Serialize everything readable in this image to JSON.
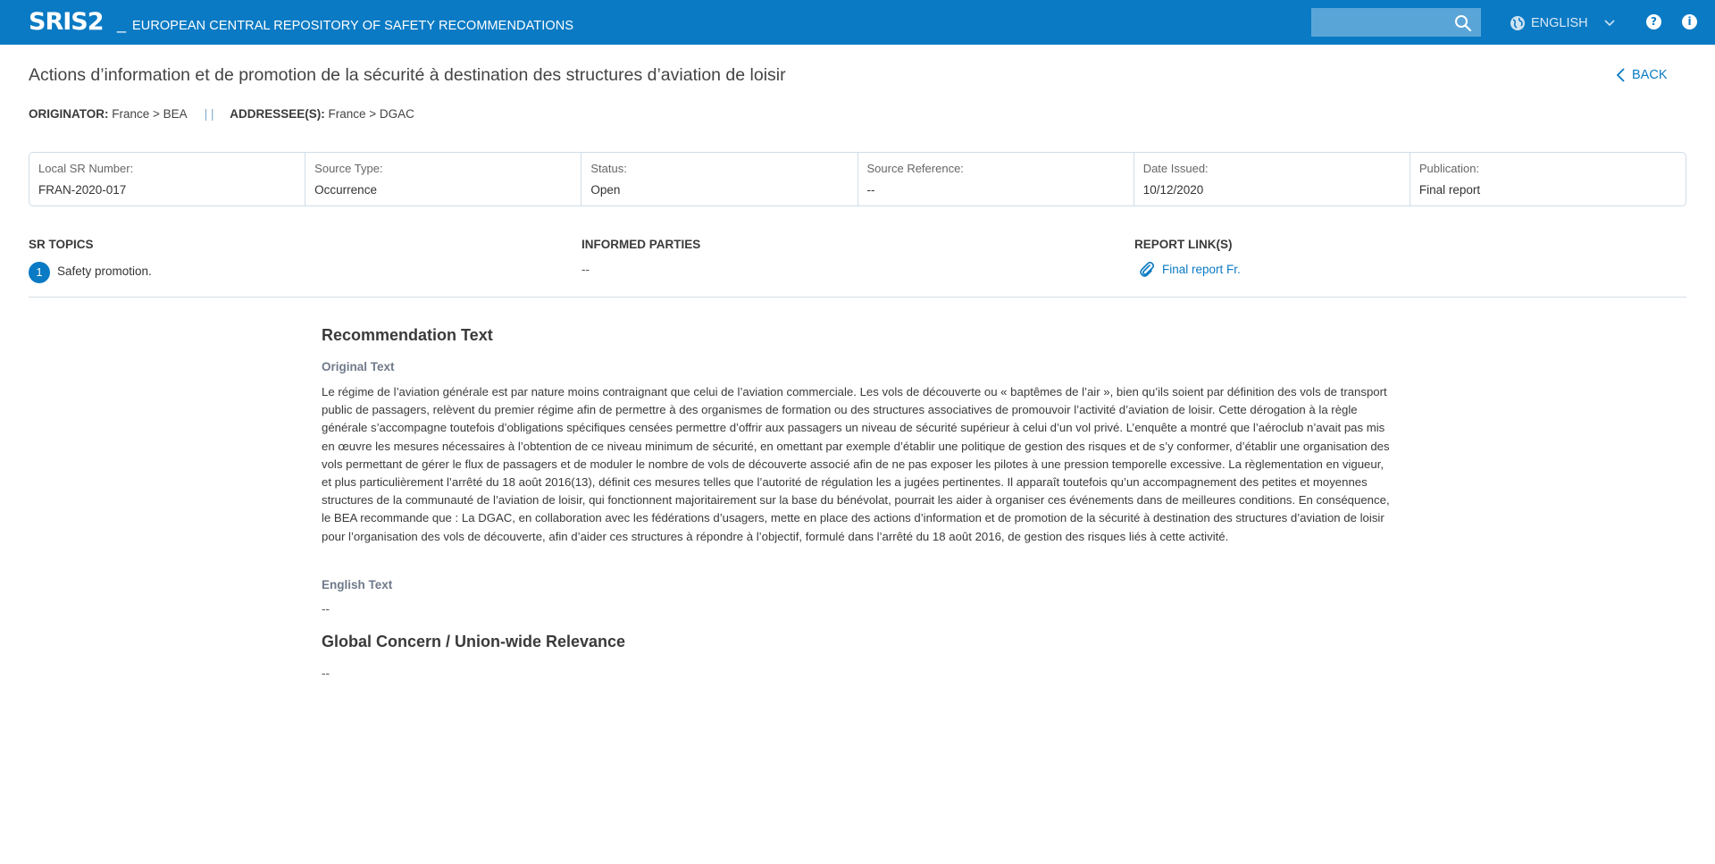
{
  "header": {
    "logo": "SRIS2",
    "dash": "_",
    "app_title": "EUROPEAN CENTRAL REPOSITORY OF SAFETY RECOMMENDATIONS",
    "search_placeholder": "",
    "language": "ENGLISH",
    "help_glyph": "?",
    "info_glyph": "i",
    "brand_color": "#0a7ac4"
  },
  "page": {
    "title": "Actions d’information et de promotion de la sécurité à destination des structures d’aviation de loisir",
    "back_label": "BACK"
  },
  "originator": {
    "originator_label": "ORIGINATOR:",
    "originator_value": "France > BEA",
    "separator": "| |",
    "addressee_label": "ADDRESSEE(S):",
    "addressee_value": "France > DGAC"
  },
  "info": [
    {
      "label": "Local SR Number:",
      "value": "FRAN-2020-017"
    },
    {
      "label": "Source Type:",
      "value": "Occurrence"
    },
    {
      "label": "Status:",
      "value": "Open"
    },
    {
      "label": "Source Reference:",
      "value": "--"
    },
    {
      "label": "Date Issued:",
      "value": "10/12/2020"
    },
    {
      "label": "Publication:",
      "value": "Final report"
    }
  ],
  "sections": {
    "sr_topics_label": "SR TOPICS",
    "topic_number": "1",
    "topic_text": "Safety promotion.",
    "informed_label": "INFORMED PARTIES",
    "informed_value": "--",
    "report_links_label": "REPORT LINK(S)",
    "report_link_text": "Final report Fr."
  },
  "recommendation": {
    "title": "Recommendation Text",
    "original_label": "Original Text",
    "original_text": "Le régime de l’aviation générale est par nature moins contraignant que celui de l’aviation commerciale. Les vols de découverte ou « baptêmes de l’air », bien qu’ils soient par définition des vols de transport public de passagers, relèvent du premier régime afin de permettre à des organismes de formation ou des structures associatives de promouvoir l’activité d’aviation de loisir. Cette dérogation à la règle générale s’accompagne toutefois d’obligations spécifiques censées permettre d’offrir aux passagers un niveau de sécurité supérieur à celui d’un vol privé. L’enquête a montré que l’aéroclub n’avait pas mis en œuvre les mesures nécessaires à l’obtention de ce niveau minimum de sécurité, en omettant par exemple d’établir une politique de gestion des risques et de s’y conformer, d’établir une organisation des vols permettant de gérer le flux de passagers et de moduler le nombre de vols de découverte associé afin de ne pas exposer les pilotes à une pression temporelle excessive. La règlementation en vigueur, et plus particulièrement l’arrêté du 18 août 2016(13), définit ces mesures telles que l’autorité de régulation les a jugées pertinentes. Il apparaît toutefois qu’un accompagnement des petites et moyennes structures de la communauté de l’aviation de loisir, qui fonctionnent majoritairement sur la base du bénévolat, pourrait les aider à organiser ces événements dans de meilleures conditions. En conséquence, le BEA recommande que : La DGAC, en collaboration avec les fédérations d’usagers, mette en place des actions d’information et de promotion de la sécurité à destination des structures d’aviation de loisir pour l’organisation des vols de découverte, afin d’aider ces structures à répondre à l’objectif, formulé dans l’arrêté du 18 août 2016, de gestion des risques liés à cette activité.",
    "english_label": "English Text",
    "english_value": "--",
    "global_title": "Global Concern / Union-wide Relevance",
    "global_value": "--"
  }
}
